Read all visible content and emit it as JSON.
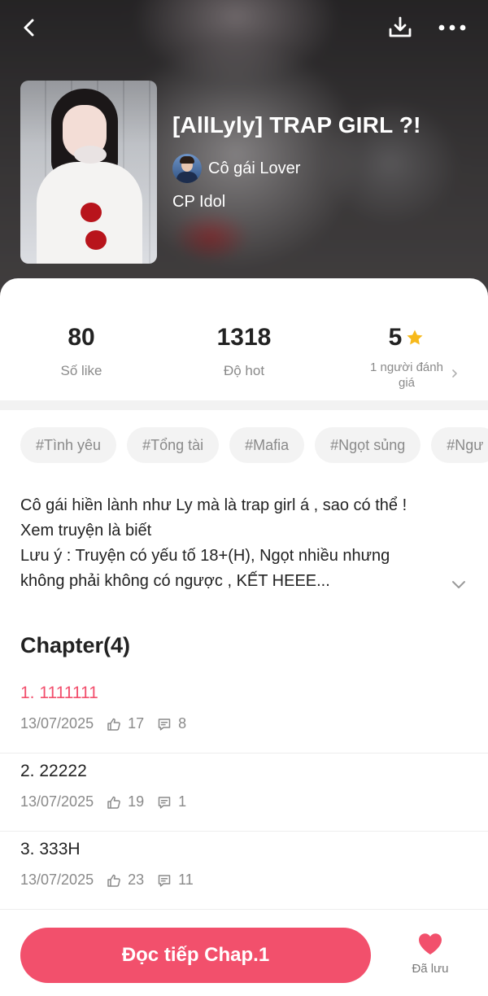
{
  "header": {
    "title": "[AllLyly] TRAP GIRL ?!",
    "author": "Cô gái Lover",
    "category": "CP Idol",
    "icons": {
      "back": "back-arrow-icon",
      "download": "download-icon",
      "more": "more-icon"
    }
  },
  "stats": {
    "likes": {
      "value": "80",
      "label": "Số like"
    },
    "hot": {
      "value": "1318",
      "label": "Độ hot"
    },
    "rating": {
      "value": "5",
      "label": "1 người đánh giá",
      "star_color": "#f7b91b"
    }
  },
  "tags": [
    "#Tình yêu",
    "#Tổng tài",
    "#Mafia",
    "#Ngọt sủng",
    "#Ngư"
  ],
  "description": {
    "lines": [
      "Cô gái hiền lành như Ly mà là trap girl á , sao có thể !",
      "Xem truyện là biết",
      "Lưu ý : Truyện có yếu tố 18+(H), Ngọt nhiều nhưng",
      "không phải không có ngược , KẾT HEEE..."
    ]
  },
  "chapters": {
    "heading": "Chapter(4)",
    "items": [
      {
        "title": "1. 1111111",
        "date": "13/07/2025",
        "likes": "17",
        "comments": "8",
        "active": true
      },
      {
        "title": "2. 22222",
        "date": "13/07/2025",
        "likes": "19",
        "comments": "1",
        "active": false
      },
      {
        "title": "3. 333H",
        "date": "13/07/2025",
        "likes": "23",
        "comments": "11",
        "active": false
      }
    ]
  },
  "bottom": {
    "read_button": "Đọc tiếp Chap.1",
    "save_label": "Đã lưu",
    "accent_color": "#f2506c"
  }
}
